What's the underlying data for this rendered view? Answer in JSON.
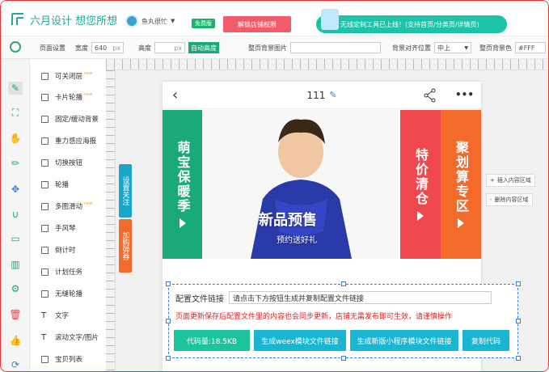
{
  "header": {
    "logo_text": "六月设计 想您所想",
    "user_name": "鱼丸很忙",
    "free_badge": "免费版",
    "unlock_label": "解锁店铺权限",
    "promo_text": "无线定制工具已上线！(支持首页/分类页/详情页)"
  },
  "settings": {
    "page_settings_label": "页面设置",
    "width_label": "宽度",
    "width_value": "640",
    "width_unit": "px",
    "height_label": "高度",
    "height_unit": "px",
    "auto_height_label": "自动高度",
    "bg_image_label": "整页背景图片",
    "bg_align_label": "背景对齐位置",
    "bg_align_value": "中上",
    "bg_color_label": "整页背景色",
    "bg_color_value": "#FFF"
  },
  "components": [
    {
      "label": "可关闭层",
      "new": "new"
    },
    {
      "label": "卡片轮播",
      "new": "new"
    },
    {
      "label": "固定/缓动背景",
      "new": ""
    },
    {
      "label": "重力感应海报",
      "new": ""
    },
    {
      "label": "切换按钮",
      "new": ""
    },
    {
      "label": "轮播",
      "new": ""
    },
    {
      "label": "多图滑动",
      "new": "new"
    },
    {
      "label": "手风琴",
      "new": ""
    },
    {
      "label": "倒计时",
      "new": ""
    },
    {
      "label": "计划任务",
      "new": ""
    },
    {
      "label": "无缝轮播",
      "new": ""
    },
    {
      "label": "文字",
      "new": ""
    },
    {
      "label": "滚动文字/图片",
      "new": ""
    },
    {
      "label": "宝贝列表",
      "new": ""
    }
  ],
  "side_tags": {
    "follow": "设置关注",
    "cart": "加购弹券"
  },
  "phone": {
    "page_title": "111",
    "more_icon": "•••"
  },
  "banner": {
    "left_text": "萌宝保暖季",
    "right1_text": "特价清仓",
    "right2_text": "聚划算专区",
    "headline": "新品预售",
    "subline": "预约送好礼",
    "colors": {
      "green": "#1aa97a",
      "red": "#f0484f",
      "orange": "#f46a2a"
    }
  },
  "insert_actions": {
    "insert": "插入内容区域",
    "delete": "删除内容区域"
  },
  "config": {
    "label": "配置文件链接",
    "input_value": "请点击下方按钮生成并复制配置文件链接",
    "warning": "页面更新保存后配置文件里的内容也会同步更新，店铺无需发布即可生效，请谨慎操作",
    "buttons": [
      {
        "label": "代码量:18.5KB",
        "color": "#1dc39a"
      },
      {
        "label": "生成weex模块文件链接",
        "color": "#1ab5d0"
      },
      {
        "label": "生成新版小程序模块文件链接",
        "color": "#1ab5d0"
      },
      {
        "label": "复制代码",
        "color": "#1ab5d0"
      }
    ]
  }
}
